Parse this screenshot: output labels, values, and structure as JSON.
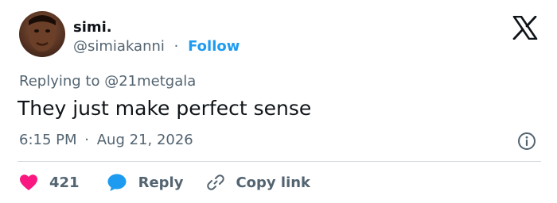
{
  "author": {
    "name": "simi.",
    "handle": "@simiakanni",
    "separator": "·",
    "follow_label": "Follow"
  },
  "reply_context": {
    "prefix": "Replying to",
    "mention": "@21metgala"
  },
  "tweet": {
    "text": "They just make perfect sense",
    "time": "6:15 PM",
    "separator": "·",
    "date": "Aug 21, 2026"
  },
  "actions": {
    "like_count": "421",
    "reply_label": "Reply",
    "copy_link_label": "Copy link"
  },
  "colors": {
    "accent": "#1d9bf0",
    "like": "#f91880",
    "text": "#0f1419",
    "muted": "#536471"
  },
  "icons": {
    "brand": "x-logo-icon",
    "like": "heart-icon",
    "reply": "speech-bubble-icon",
    "copy": "link-icon",
    "info": "info-icon"
  }
}
